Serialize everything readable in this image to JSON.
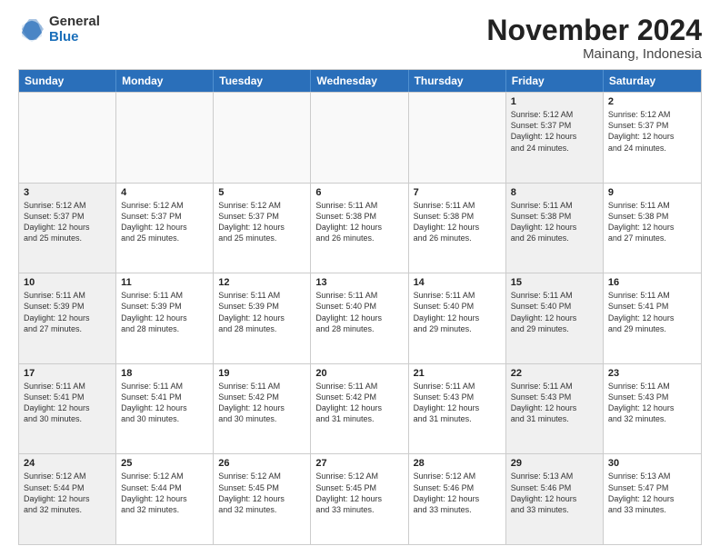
{
  "logo": {
    "general": "General",
    "blue": "Blue"
  },
  "header": {
    "month": "November 2024",
    "location": "Mainang, Indonesia"
  },
  "weekdays": [
    "Sunday",
    "Monday",
    "Tuesday",
    "Wednesday",
    "Thursday",
    "Friday",
    "Saturday"
  ],
  "weeks": [
    [
      {
        "day": "",
        "text": "",
        "empty": true
      },
      {
        "day": "",
        "text": "",
        "empty": true
      },
      {
        "day": "",
        "text": "",
        "empty": true
      },
      {
        "day": "",
        "text": "",
        "empty": true
      },
      {
        "day": "",
        "text": "",
        "empty": true
      },
      {
        "day": "1",
        "text": "Sunrise: 5:12 AM\nSunset: 5:37 PM\nDaylight: 12 hours\nand 24 minutes.",
        "shaded": true
      },
      {
        "day": "2",
        "text": "Sunrise: 5:12 AM\nSunset: 5:37 PM\nDaylight: 12 hours\nand 24 minutes.",
        "shaded": false
      }
    ],
    [
      {
        "day": "3",
        "text": "Sunrise: 5:12 AM\nSunset: 5:37 PM\nDaylight: 12 hours\nand 25 minutes.",
        "shaded": true
      },
      {
        "day": "4",
        "text": "Sunrise: 5:12 AM\nSunset: 5:37 PM\nDaylight: 12 hours\nand 25 minutes.",
        "shaded": false
      },
      {
        "day": "5",
        "text": "Sunrise: 5:12 AM\nSunset: 5:37 PM\nDaylight: 12 hours\nand 25 minutes.",
        "shaded": false
      },
      {
        "day": "6",
        "text": "Sunrise: 5:11 AM\nSunset: 5:38 PM\nDaylight: 12 hours\nand 26 minutes.",
        "shaded": false
      },
      {
        "day": "7",
        "text": "Sunrise: 5:11 AM\nSunset: 5:38 PM\nDaylight: 12 hours\nand 26 minutes.",
        "shaded": false
      },
      {
        "day": "8",
        "text": "Sunrise: 5:11 AM\nSunset: 5:38 PM\nDaylight: 12 hours\nand 26 minutes.",
        "shaded": true
      },
      {
        "day": "9",
        "text": "Sunrise: 5:11 AM\nSunset: 5:38 PM\nDaylight: 12 hours\nand 27 minutes.",
        "shaded": false
      }
    ],
    [
      {
        "day": "10",
        "text": "Sunrise: 5:11 AM\nSunset: 5:39 PM\nDaylight: 12 hours\nand 27 minutes.",
        "shaded": true
      },
      {
        "day": "11",
        "text": "Sunrise: 5:11 AM\nSunset: 5:39 PM\nDaylight: 12 hours\nand 28 minutes.",
        "shaded": false
      },
      {
        "day": "12",
        "text": "Sunrise: 5:11 AM\nSunset: 5:39 PM\nDaylight: 12 hours\nand 28 minutes.",
        "shaded": false
      },
      {
        "day": "13",
        "text": "Sunrise: 5:11 AM\nSunset: 5:40 PM\nDaylight: 12 hours\nand 28 minutes.",
        "shaded": false
      },
      {
        "day": "14",
        "text": "Sunrise: 5:11 AM\nSunset: 5:40 PM\nDaylight: 12 hours\nand 29 minutes.",
        "shaded": false
      },
      {
        "day": "15",
        "text": "Sunrise: 5:11 AM\nSunset: 5:40 PM\nDaylight: 12 hours\nand 29 minutes.",
        "shaded": true
      },
      {
        "day": "16",
        "text": "Sunrise: 5:11 AM\nSunset: 5:41 PM\nDaylight: 12 hours\nand 29 minutes.",
        "shaded": false
      }
    ],
    [
      {
        "day": "17",
        "text": "Sunrise: 5:11 AM\nSunset: 5:41 PM\nDaylight: 12 hours\nand 30 minutes.",
        "shaded": true
      },
      {
        "day": "18",
        "text": "Sunrise: 5:11 AM\nSunset: 5:41 PM\nDaylight: 12 hours\nand 30 minutes.",
        "shaded": false
      },
      {
        "day": "19",
        "text": "Sunrise: 5:11 AM\nSunset: 5:42 PM\nDaylight: 12 hours\nand 30 minutes.",
        "shaded": false
      },
      {
        "day": "20",
        "text": "Sunrise: 5:11 AM\nSunset: 5:42 PM\nDaylight: 12 hours\nand 31 minutes.",
        "shaded": false
      },
      {
        "day": "21",
        "text": "Sunrise: 5:11 AM\nSunset: 5:43 PM\nDaylight: 12 hours\nand 31 minutes.",
        "shaded": false
      },
      {
        "day": "22",
        "text": "Sunrise: 5:11 AM\nSunset: 5:43 PM\nDaylight: 12 hours\nand 31 minutes.",
        "shaded": true
      },
      {
        "day": "23",
        "text": "Sunrise: 5:11 AM\nSunset: 5:43 PM\nDaylight: 12 hours\nand 32 minutes.",
        "shaded": false
      }
    ],
    [
      {
        "day": "24",
        "text": "Sunrise: 5:12 AM\nSunset: 5:44 PM\nDaylight: 12 hours\nand 32 minutes.",
        "shaded": true
      },
      {
        "day": "25",
        "text": "Sunrise: 5:12 AM\nSunset: 5:44 PM\nDaylight: 12 hours\nand 32 minutes.",
        "shaded": false
      },
      {
        "day": "26",
        "text": "Sunrise: 5:12 AM\nSunset: 5:45 PM\nDaylight: 12 hours\nand 32 minutes.",
        "shaded": false
      },
      {
        "day": "27",
        "text": "Sunrise: 5:12 AM\nSunset: 5:45 PM\nDaylight: 12 hours\nand 33 minutes.",
        "shaded": false
      },
      {
        "day": "28",
        "text": "Sunrise: 5:12 AM\nSunset: 5:46 PM\nDaylight: 12 hours\nand 33 minutes.",
        "shaded": false
      },
      {
        "day": "29",
        "text": "Sunrise: 5:13 AM\nSunset: 5:46 PM\nDaylight: 12 hours\nand 33 minutes.",
        "shaded": true
      },
      {
        "day": "30",
        "text": "Sunrise: 5:13 AM\nSunset: 5:47 PM\nDaylight: 12 hours\nand 33 minutes.",
        "shaded": false
      }
    ]
  ]
}
